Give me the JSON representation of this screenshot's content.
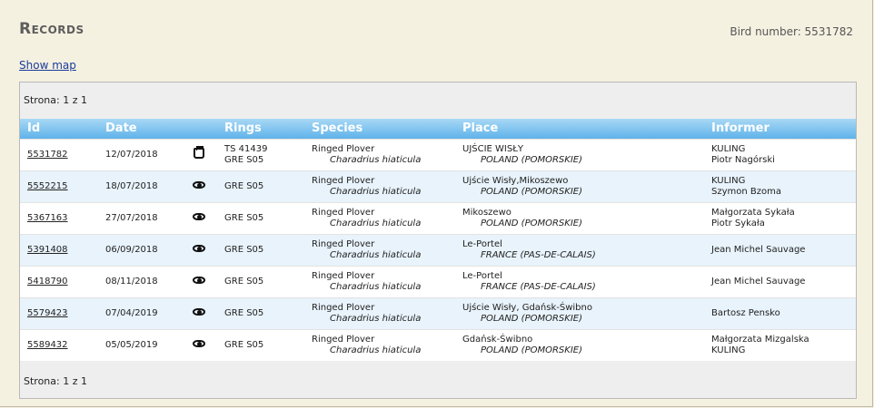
{
  "header": {
    "title": "Records",
    "bird_number_label": "Bird number: 5531782",
    "show_map_label": "Show map"
  },
  "pager": {
    "top": "Strona: 1 z 1",
    "bottom": "Strona: 1 z 1"
  },
  "columns": [
    "Id",
    "Date",
    "",
    "Rings",
    "Species",
    "Place",
    "Informer"
  ],
  "rows": [
    {
      "id": "5531782",
      "date": "12/07/2018",
      "icon": "ring-icon",
      "rings": [
        "TS 41439",
        "GRE S05"
      ],
      "species": "Ringed Plover",
      "latin": "Charadrius hiaticula",
      "place": "UJŚCIE WISŁY",
      "country": "POLAND (POMORSKIE)",
      "informer": [
        "KULING",
        "Piotr Nagórski"
      ]
    },
    {
      "id": "5552215",
      "date": "18/07/2018",
      "icon": "eye-icon",
      "rings": [
        "GRE S05"
      ],
      "species": "Ringed Plover",
      "latin": "Charadrius hiaticula",
      "place": "Ujście Wisły,Mikoszewo",
      "country": "POLAND (POMORSKIE)",
      "informer": [
        "KULING",
        "Szymon Bzoma"
      ]
    },
    {
      "id": "5367163",
      "date": "27/07/2018",
      "icon": "eye-icon",
      "rings": [
        "GRE S05"
      ],
      "species": "Ringed Plover",
      "latin": "Charadrius hiaticula",
      "place": "Mikoszewo",
      "country": "POLAND (POMORSKIE)",
      "informer": [
        "Małgorzata Sykała",
        "Piotr Sykała"
      ]
    },
    {
      "id": "5391408",
      "date": "06/09/2018",
      "icon": "eye-icon",
      "rings": [
        "GRE S05"
      ],
      "species": "Ringed Plover",
      "latin": "Charadrius hiaticula",
      "place": "Le-Portel",
      "country": "FRANCE (PAS-DE-CALAIS)",
      "informer": [
        "Jean Michel Sauvage"
      ]
    },
    {
      "id": "5418790",
      "date": "08/11/2018",
      "icon": "eye-icon",
      "rings": [
        "GRE S05"
      ],
      "species": "Ringed Plover",
      "latin": "Charadrius hiaticula",
      "place": "Le-Portel",
      "country": "FRANCE (PAS-DE-CALAIS)",
      "informer": [
        "Jean Michel Sauvage"
      ]
    },
    {
      "id": "5579423",
      "date": "07/04/2019",
      "icon": "eye-icon",
      "rings": [
        "GRE S05"
      ],
      "species": "Ringed Plover",
      "latin": "Charadrius hiaticula",
      "place": "Ujście Wisły, Gdańsk-Świbno",
      "country": "POLAND (POMORSKIE)",
      "informer": [
        "Bartosz Pensko"
      ]
    },
    {
      "id": "5589432",
      "date": "05/05/2019",
      "icon": "eye-icon",
      "rings": [
        "GRE S05"
      ],
      "species": "Ringed Plover",
      "latin": "Charadrius hiaticula",
      "place": "Gdańsk-Świbno",
      "country": "POLAND (POMORSKIE)",
      "informer": [
        "Małgorzata Mizgalska",
        "KULING"
      ]
    }
  ]
}
